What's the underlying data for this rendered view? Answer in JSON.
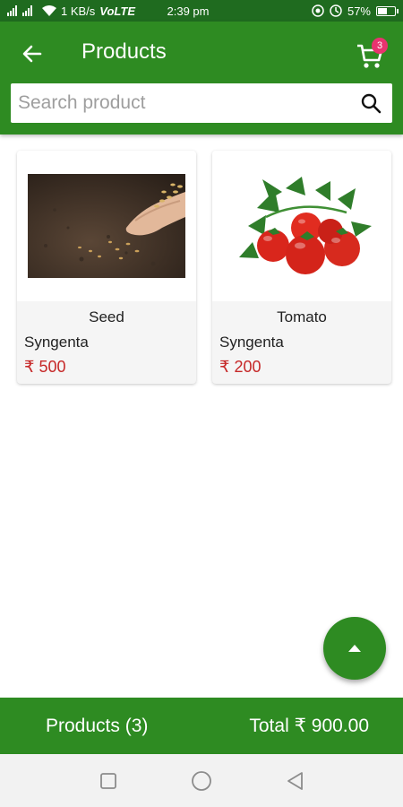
{
  "status_bar": {
    "signal_text": "1 KB/s",
    "network": "VoLTE",
    "time": "2:39 pm",
    "battery_percent": "57%",
    "battery_level": 0.57
  },
  "app_bar": {
    "title": "Products",
    "cart_count": "3"
  },
  "search": {
    "placeholder": "Search product",
    "value": ""
  },
  "products": [
    {
      "name": "Seed",
      "brand": "Syngenta",
      "price": "₹ 500",
      "image": "seed-image"
    },
    {
      "name": "Tomato",
      "brand": "Syngenta",
      "price": "₹ 200",
      "image": "tomato-image"
    }
  ],
  "footer": {
    "products_label": "Products (3)",
    "total_label": "Total ₹ 900.00"
  },
  "colors": {
    "primary": "#2e8b22",
    "status_bar": "#1f6b1f",
    "price": "#c62828",
    "badge": "#e8336f"
  },
  "icons": [
    "back-arrow-icon",
    "cart-icon",
    "search-icon",
    "scroll-up-icon",
    "nav-recent-icon",
    "nav-home-icon",
    "nav-back-icon"
  ]
}
